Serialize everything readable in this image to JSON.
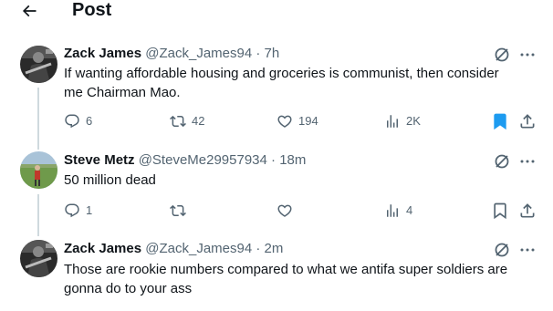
{
  "header": {
    "title": "Post"
  },
  "posts": [
    {
      "name": "Zack James",
      "handle": "@Zack_James94",
      "time": "7h",
      "text": "If wanting affordable housing and groceries is communist, then consider me Chairman Mao.",
      "replies": "6",
      "reposts": "42",
      "likes": "194",
      "views": "2K",
      "bookmarked": true
    },
    {
      "name": "Steve Metz",
      "handle": "@SteveMe29957934",
      "time": "18m",
      "text": "50 million dead",
      "replies": "1",
      "reposts": "",
      "likes": "",
      "views": "4",
      "bookmarked": false
    },
    {
      "name": "Zack James",
      "handle": "@Zack_James94",
      "time": "2m",
      "text": "Those are rookie numbers compared to what we antifa super soldiers are gonna do to your ass",
      "replies": "",
      "reposts": "",
      "likes": "",
      "views": "",
      "bookmarked": false
    }
  ],
  "meta_separator": " · ",
  "colors": {
    "accent": "#1d9bf0",
    "muted": "#536471",
    "text": "#0f1419"
  }
}
